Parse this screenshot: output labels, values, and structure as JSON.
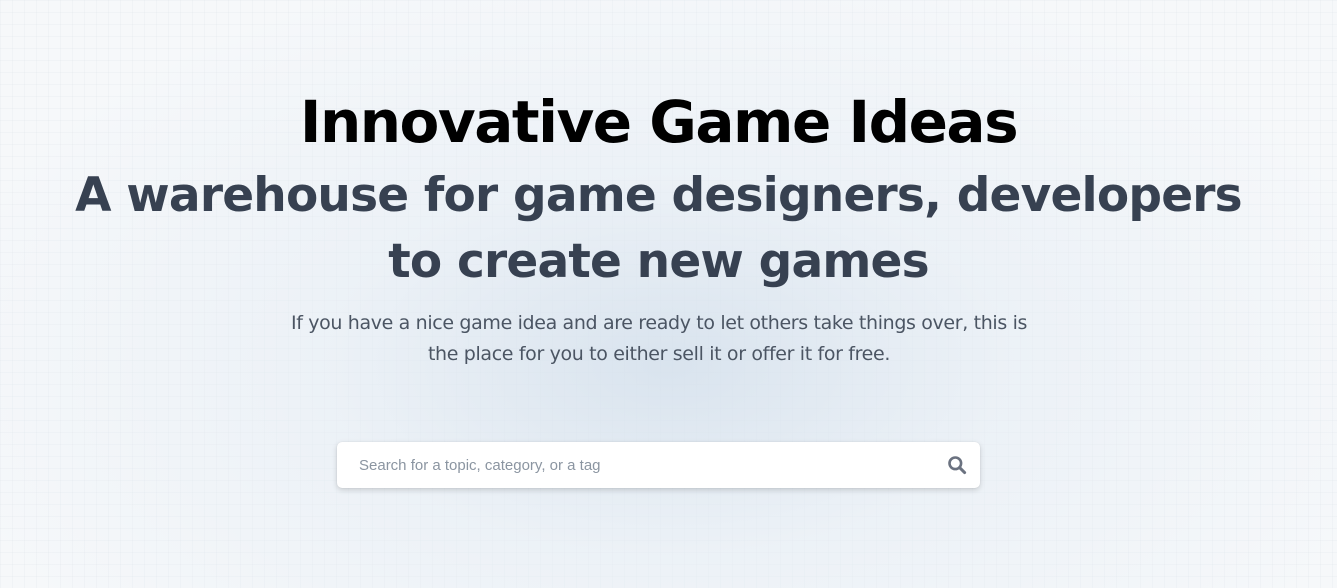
{
  "hero": {
    "title": "Innovative Game Ideas",
    "subtitle": "A warehouse for game designers, developers to create new games",
    "description": "If you have a nice game idea and are ready to let others take things over, this is the place for you to either sell it or offer it for free."
  },
  "search": {
    "placeholder": "Search for a topic, category, or a tag",
    "value": "",
    "icon": "search-icon"
  },
  "colors": {
    "title": "#000000",
    "subtitle": "#374151",
    "description": "#4b5563",
    "placeholder": "#8b95a1",
    "icon": "#6b7280",
    "background": "#f6f8fa"
  }
}
